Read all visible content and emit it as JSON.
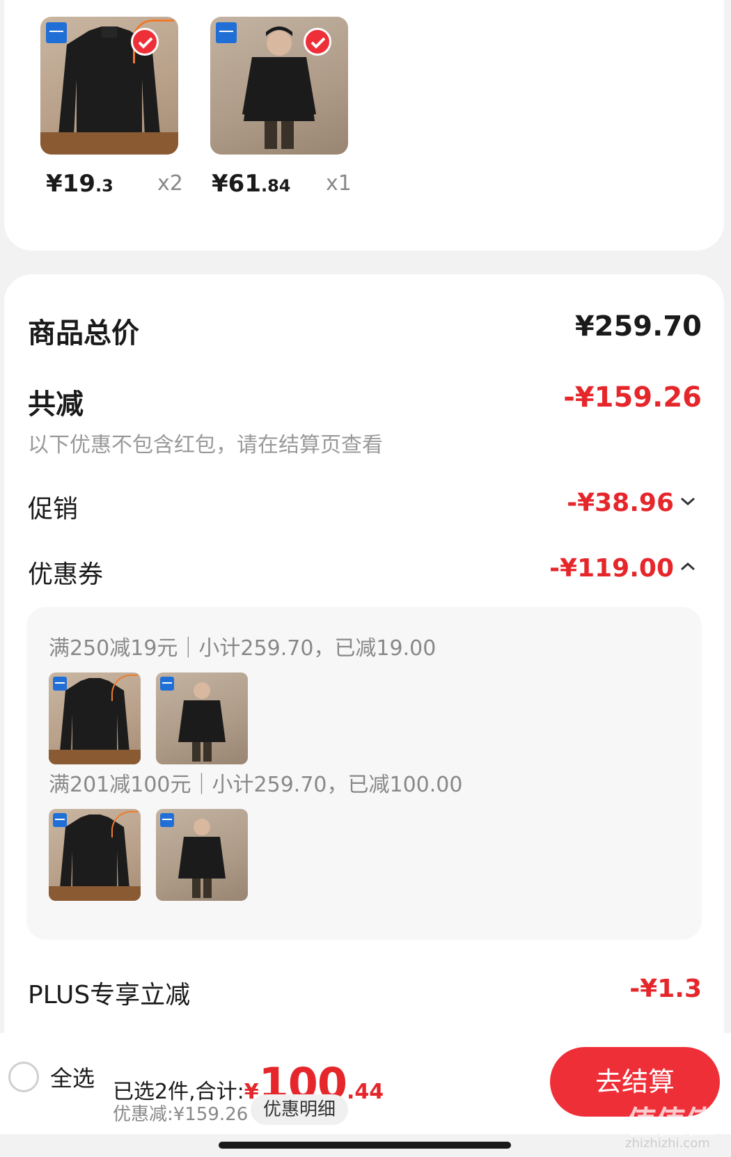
{
  "colors": {
    "accent": "#e5262b",
    "page_bg": "#f2f2f2"
  },
  "cart_items": [
    {
      "price_int": "¥19",
      "price_dec": ".3",
      "qty": "x2",
      "icon": "sweater-thumbnail"
    },
    {
      "price_int": "¥61",
      "price_dec": ".84",
      "qty": "x1",
      "icon": "coat-thumbnail"
    }
  ],
  "summary": {
    "total_label": "商品总价",
    "total_value": "¥259.70",
    "reduction_label": "共减",
    "reduction_value": "-¥159.26",
    "reduction_note": "以下优惠不包含红包，请在结算页查看",
    "promo_label": "促销",
    "promo_value": "-¥38.96",
    "coupon_label": "优惠券",
    "coupon_value": "-¥119.00",
    "plus_label": "PLUS专享立减",
    "plus_value": "-¥1.3"
  },
  "coupons": [
    {
      "text": "满250减19元｜小计259.70，已减19.00"
    },
    {
      "text": "满201减100元｜小计259.70，已减100.00"
    }
  ],
  "bottom_bar": {
    "select_all": "全选",
    "selected_text": "已选2件,合计:",
    "yen": "¥",
    "total_big": "100",
    "total_small": ".44",
    "discount_text": "优惠减:¥159.26",
    "detail_button": "优惠明细",
    "checkout_button": "去结算"
  },
  "watermark": {
    "main": "值值值",
    "sub": "zhizhizhi.com"
  }
}
